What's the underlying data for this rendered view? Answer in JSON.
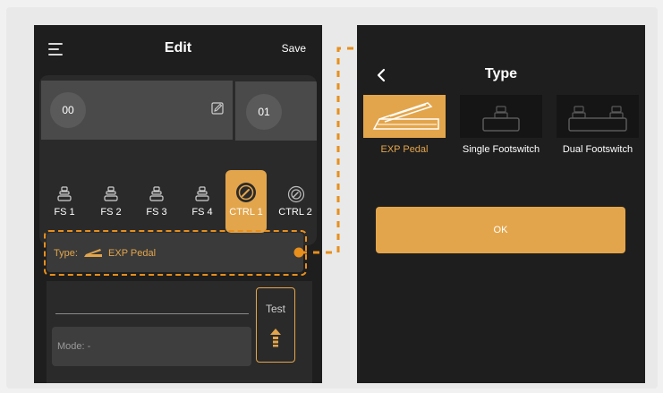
{
  "left_screen": {
    "title": "Edit",
    "save_label": "Save",
    "presets": [
      {
        "number": "00"
      },
      {
        "number": "01"
      }
    ],
    "footswitches": [
      {
        "label": "FS 1",
        "active": false
      },
      {
        "label": "FS 2",
        "active": false
      },
      {
        "label": "FS 3",
        "active": false
      },
      {
        "label": "FS 4",
        "active": false
      },
      {
        "label": "CTRL 1",
        "active": true
      },
      {
        "label": "CTRL 2",
        "active": false
      }
    ],
    "type_field": {
      "label": "Type:",
      "value": "EXP Pedal",
      "icon": "exp-pedal-icon"
    },
    "mode_field": {
      "label": "Mode: -"
    },
    "test_button": {
      "label": "Test",
      "icon": "arrow-up-icon"
    }
  },
  "right_screen": {
    "title": "Type",
    "back_icon": "chevron-left-icon",
    "options": [
      {
        "label": "EXP Pedal",
        "selected": true,
        "icon": "exp-pedal-icon"
      },
      {
        "label": "Single Footswitch",
        "selected": false,
        "icon": "single-footswitch-icon"
      },
      {
        "label": "Dual Footswitch",
        "selected": false,
        "icon": "dual-footswitch-icon"
      }
    ],
    "ok_label": "OK"
  },
  "colors": {
    "accent": "#e3a54b",
    "highlight_dash": "#e88f1c",
    "screen_bg": "#1e1e1e",
    "page_bg": "#f1f1f1"
  }
}
